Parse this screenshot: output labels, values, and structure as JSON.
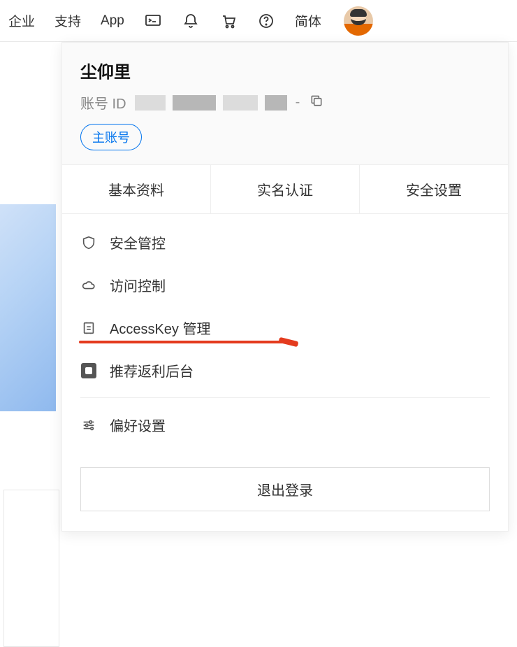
{
  "topnav": {
    "enterprise": "企业",
    "support": "支持",
    "app": "App",
    "language": "简体"
  },
  "dropdown": {
    "username": "尘仰里",
    "account_id_label": "账号 ID",
    "badge": "主账号",
    "tabs": {
      "basic": "基本资料",
      "verify": "实名认证",
      "security": "安全设置"
    },
    "items": {
      "control": "安全管控",
      "ram": "访问控制",
      "accesskey": "AccessKey 管理",
      "rebate": "推荐返利后台",
      "preference": "偏好设置"
    },
    "logout": "退出登录"
  }
}
